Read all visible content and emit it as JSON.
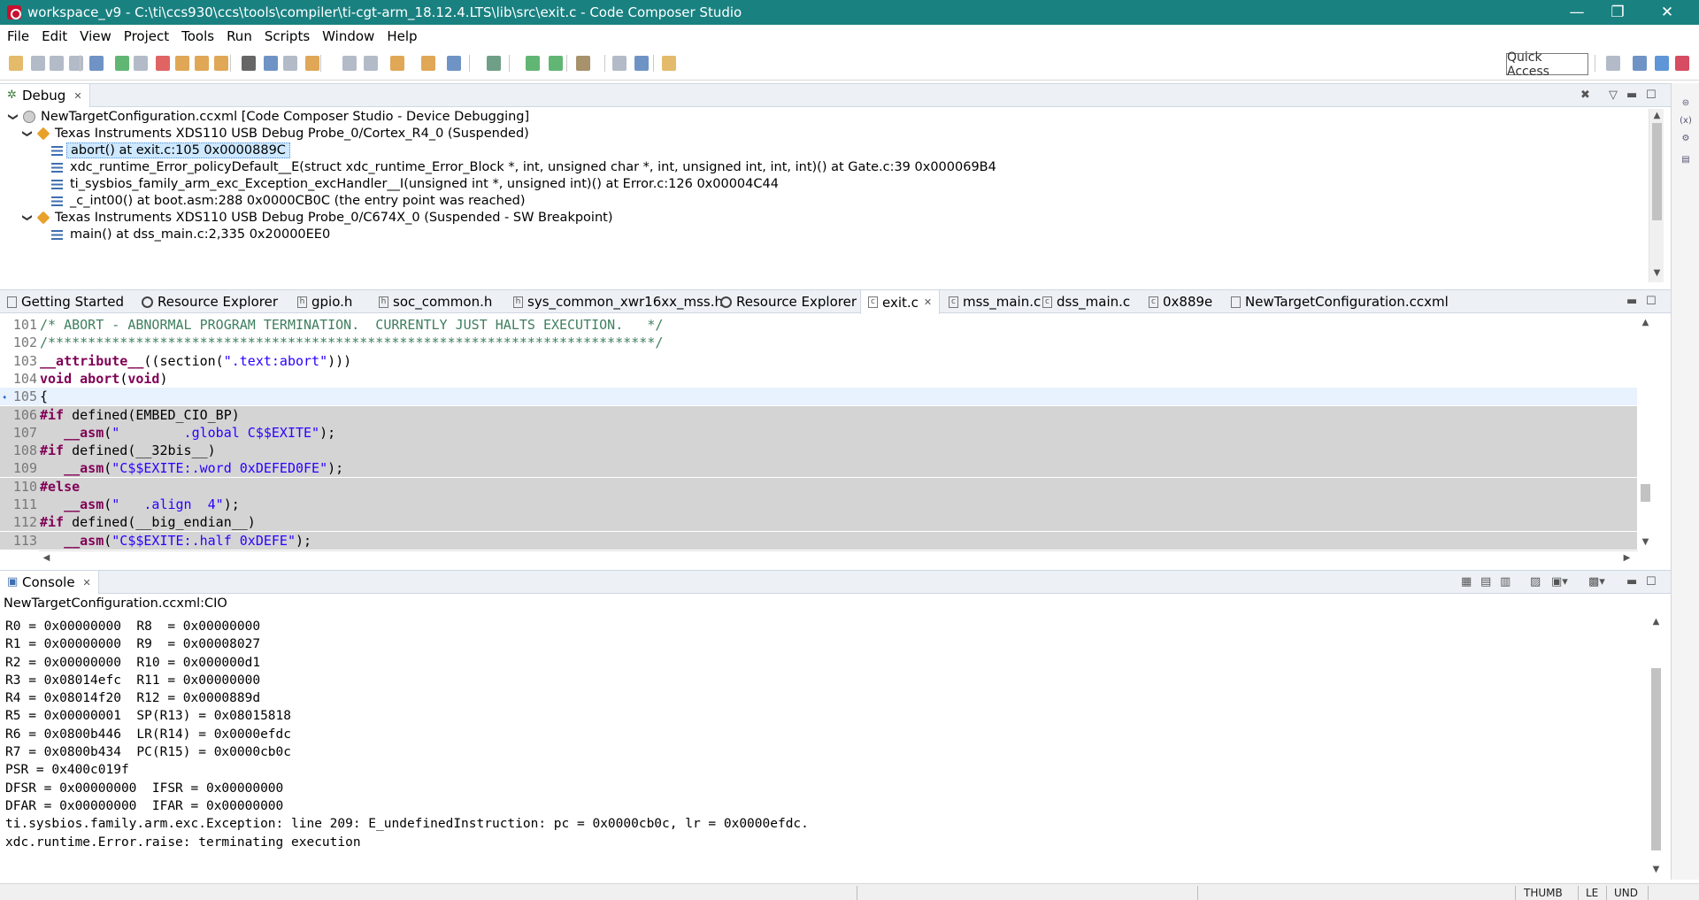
{
  "window": {
    "title": "workspace_v9 - C:\\ti\\ccs930\\ccs\\tools\\compiler\\ti-cgt-arm_18.12.4.LTS\\lib\\src\\exit.c - Code Composer Studio",
    "minimize": "—",
    "restore": "❐",
    "close": "✕"
  },
  "menu": [
    "File",
    "Edit",
    "View",
    "Project",
    "Tools",
    "Run",
    "Scripts",
    "Window",
    "Help"
  ],
  "toolbar": {
    "quick_access": "Quick Access"
  },
  "debug": {
    "tab_label": "Debug",
    "tree": [
      {
        "level": 0,
        "icon": "config",
        "label": "NewTargetConfiguration.ccxml [Code Composer Studio - Device Debugging]"
      },
      {
        "level": 1,
        "icon": "core",
        "label": "Texas Instruments XDS110 USB Debug Probe_0/Cortex_R4_0 (Suspended)"
      },
      {
        "level": 2,
        "icon": "frame",
        "label": "abort() at exit.c:105 0x0000889C",
        "selected": true
      },
      {
        "level": 2,
        "icon": "frame",
        "label": "xdc_runtime_Error_policyDefault__E(struct xdc_runtime_Error_Block *, int, unsigned char *, int, unsigned int, int, int)() at Gate.c:39 0x000069B4"
      },
      {
        "level": 2,
        "icon": "frame",
        "label": "ti_sysbios_family_arm_exc_Exception_excHandler__I(unsigned int *, unsigned int)() at Error.c:126 0x00004C44"
      },
      {
        "level": 2,
        "icon": "frame",
        "label": "_c_int00() at boot.asm:288 0x0000CB0C  (the entry point was reached)"
      },
      {
        "level": 1,
        "icon": "core",
        "label": "Texas Instruments XDS110 USB Debug Probe_0/C674X_0 (Suspended - SW Breakpoint)"
      },
      {
        "level": 2,
        "icon": "frame",
        "label": "main() at dss_main.c:2,335 0x20000EE0"
      }
    ]
  },
  "editor": {
    "tabs": [
      {
        "label": "Getting Started",
        "icon": "doc"
      },
      {
        "label": "Resource Explorer",
        "icon": "circle"
      },
      {
        "label": "gpio.h",
        "icon": "h"
      },
      {
        "label": "soc_common.h",
        "icon": "h"
      },
      {
        "label": "sys_common_xwr16xx_mss.h",
        "icon": "h"
      },
      {
        "label": "Resource Explorer",
        "icon": "circle"
      },
      {
        "label": "exit.c",
        "icon": "c",
        "active": true
      },
      {
        "label": "mss_main.c",
        "icon": "c"
      },
      {
        "label": "dss_main.c",
        "icon": "c"
      },
      {
        "label": "0x889e",
        "icon": "c"
      },
      {
        "label": "NewTargetConfiguration.ccxml",
        "icon": "doc"
      }
    ],
    "lines": [
      {
        "n": "101",
        "hl": false,
        "cur": false,
        "tokens": [
          {
            "t": "/* ABORT - ABNORMAL PROGRAM TERMINATION.  CURRENTLY JUST HALTS EXECUTION.   */",
            "c": "com"
          }
        ]
      },
      {
        "n": "102",
        "hl": false,
        "cur": false,
        "tokens": [
          {
            "t": "/****************************************************************************/",
            "c": "com"
          }
        ]
      },
      {
        "n": "103",
        "hl": false,
        "cur": false,
        "tokens": [
          {
            "t": "__attribute__",
            "c": "kw"
          },
          {
            "t": "((section(",
            "c": ""
          },
          {
            "t": "\".text:abort\"",
            "c": "str"
          },
          {
            "t": ")))",
            "c": ""
          }
        ]
      },
      {
        "n": "104",
        "hl": false,
        "cur": false,
        "tokens": [
          {
            "t": "void",
            "c": "kw"
          },
          {
            "t": " ",
            "c": ""
          },
          {
            "t": "abort",
            "c": "kw"
          },
          {
            "t": "(",
            "c": ""
          },
          {
            "t": "void",
            "c": "kw"
          },
          {
            "t": ")",
            "c": ""
          }
        ]
      },
      {
        "n": "105",
        "hl": false,
        "cur": true,
        "tokens": [
          {
            "t": "{",
            "c": ""
          }
        ]
      },
      {
        "n": "106",
        "hl": true,
        "cur": false,
        "tokens": [
          {
            "t": "#if",
            "c": "kw"
          },
          {
            "t": " defined(EMBED_CIO_BP)",
            "c": ""
          }
        ]
      },
      {
        "n": "107",
        "hl": true,
        "cur": false,
        "tokens": [
          {
            "t": "   ",
            "c": ""
          },
          {
            "t": "__asm",
            "c": "kw"
          },
          {
            "t": "(",
            "c": ""
          },
          {
            "t": "\"        .global C$$EXITE\"",
            "c": "str"
          },
          {
            "t": ");",
            "c": ""
          }
        ]
      },
      {
        "n": "108",
        "hl": true,
        "cur": false,
        "tokens": [
          {
            "t": "#if",
            "c": "kw"
          },
          {
            "t": " defined(__32bis__)",
            "c": ""
          }
        ]
      },
      {
        "n": "109",
        "hl": true,
        "cur": false,
        "tokens": [
          {
            "t": "   ",
            "c": ""
          },
          {
            "t": "__asm",
            "c": "kw"
          },
          {
            "t": "(",
            "c": ""
          },
          {
            "t": "\"C$$EXITE:.word 0xDEFED0FE\"",
            "c": "str"
          },
          {
            "t": ");",
            "c": ""
          }
        ]
      },
      {
        "n": "110",
        "hl": true,
        "cur": false,
        "tokens": [
          {
            "t": "#else",
            "c": "kw"
          }
        ]
      },
      {
        "n": "111",
        "hl": true,
        "cur": false,
        "tokens": [
          {
            "t": "   ",
            "c": ""
          },
          {
            "t": "__asm",
            "c": "kw"
          },
          {
            "t": "(",
            "c": ""
          },
          {
            "t": "\"   .align  4\"",
            "c": "str"
          },
          {
            "t": ");",
            "c": ""
          }
        ]
      },
      {
        "n": "112",
        "hl": true,
        "cur": false,
        "tokens": [
          {
            "t": "#if",
            "c": "kw"
          },
          {
            "t": " defined(__big_endian__)",
            "c": ""
          }
        ]
      },
      {
        "n": "113",
        "hl": true,
        "cur": false,
        "tokens": [
          {
            "t": "   ",
            "c": ""
          },
          {
            "t": "__asm",
            "c": "kw"
          },
          {
            "t": "(",
            "c": ""
          },
          {
            "t": "\"C$$EXITE:.half 0xDEFE\"",
            "c": "str"
          },
          {
            "t": ");",
            "c": ""
          }
        ]
      }
    ]
  },
  "console": {
    "tab_label": "Console",
    "subtitle": "NewTargetConfiguration.ccxml:CIO",
    "lines": [
      "R0 = 0x00000000  R8  = 0x00000000",
      "R1 = 0x00000000  R9  = 0x00008027",
      "R2 = 0x00000000  R10 = 0x000000d1",
      "R3 = 0x08014efc  R11 = 0x00000000",
      "R4 = 0x08014f20  R12 = 0x0000889d",
      "R5 = 0x00000001  SP(R13) = 0x08015818",
      "R6 = 0x0800b446  LR(R14) = 0x0000efdc",
      "R7 = 0x0800b434  PC(R15) = 0x0000cb0c",
      "PSR = 0x400c019f",
      "DFSR = 0x00000000  IFSR = 0x00000000",
      "DFAR = 0x00000000  IFAR = 0x00000000",
      "ti.sysbios.family.arm.exc.Exception: line 209: E_undefinedInstruction: pc = 0x0000cb0c, lr = 0x0000efdc.",
      "xdc.runtime.Error.raise: terminating execution"
    ]
  },
  "status": [
    "THUMB",
    "LE",
    "UND"
  ],
  "colors": {
    "titlebar": "#1a8181",
    "keyword": "#7f0055",
    "string": "#2a00ff",
    "comment": "#3f7f5f",
    "selection": "#cde8ff"
  }
}
